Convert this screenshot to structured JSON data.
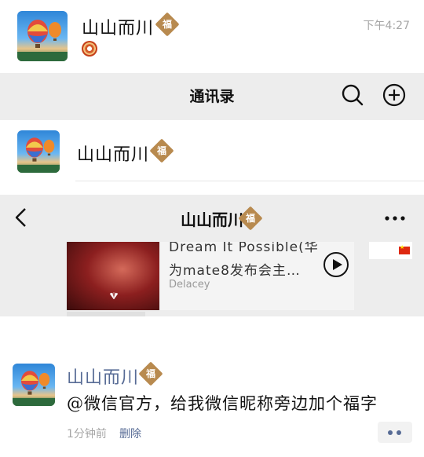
{
  "chat": {
    "name": "山山而川",
    "badge": "福",
    "time": "下午4:27"
  },
  "contacts": {
    "title": "通讯录",
    "contact_name": "山山而川",
    "badge": "福"
  },
  "moments": {
    "title": "山山而川",
    "badge": "福",
    "music": {
      "title": "Dream It Possible(华为mate8发布会主…",
      "artist": "Delacey"
    },
    "post": {
      "author": "山山而川",
      "badge": "福",
      "text": "@微信官方，给我微信昵称旁边加个福字",
      "time": "1分钟前",
      "delete_label": "删除"
    }
  },
  "colors": {
    "link_blue": "#576b95",
    "badge_gold": "#b88a4f",
    "header_gray": "#ededed"
  },
  "icons": [
    "search-icon",
    "add-icon",
    "back-icon",
    "more-icon",
    "play-icon",
    "comment-icon"
  ]
}
